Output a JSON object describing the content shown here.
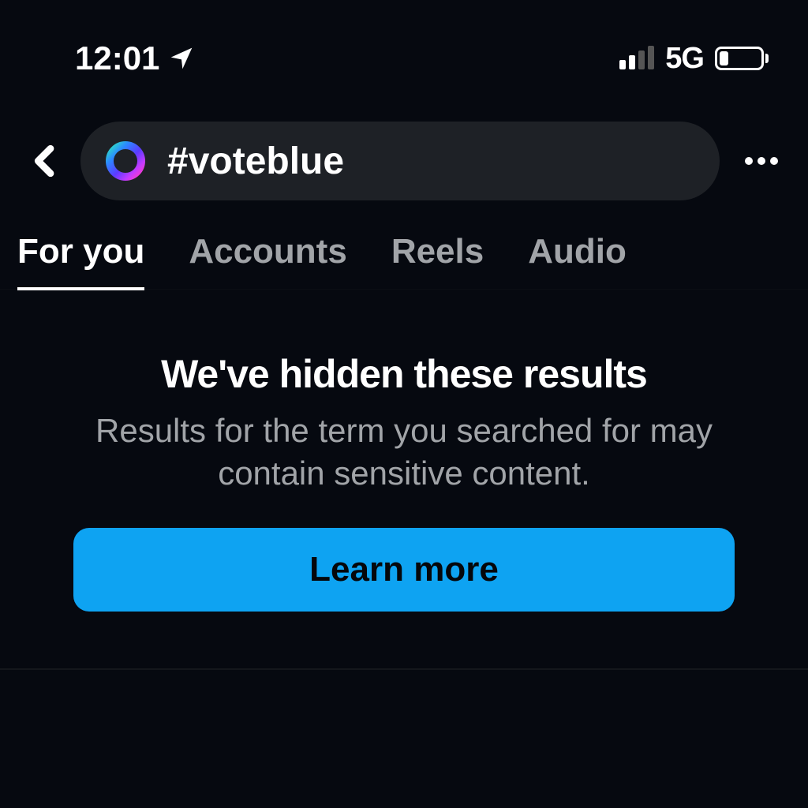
{
  "status_bar": {
    "time": "12:01",
    "network_type": "5G"
  },
  "search": {
    "query": "#voteblue"
  },
  "tabs": {
    "items": [
      {
        "label": "For you"
      },
      {
        "label": "Accounts"
      },
      {
        "label": "Reels"
      },
      {
        "label": "Audio"
      }
    ]
  },
  "content": {
    "title": "We've hidden these results",
    "body": "Results for the term you searched for may contain sensitive content.",
    "cta_label": "Learn more"
  }
}
